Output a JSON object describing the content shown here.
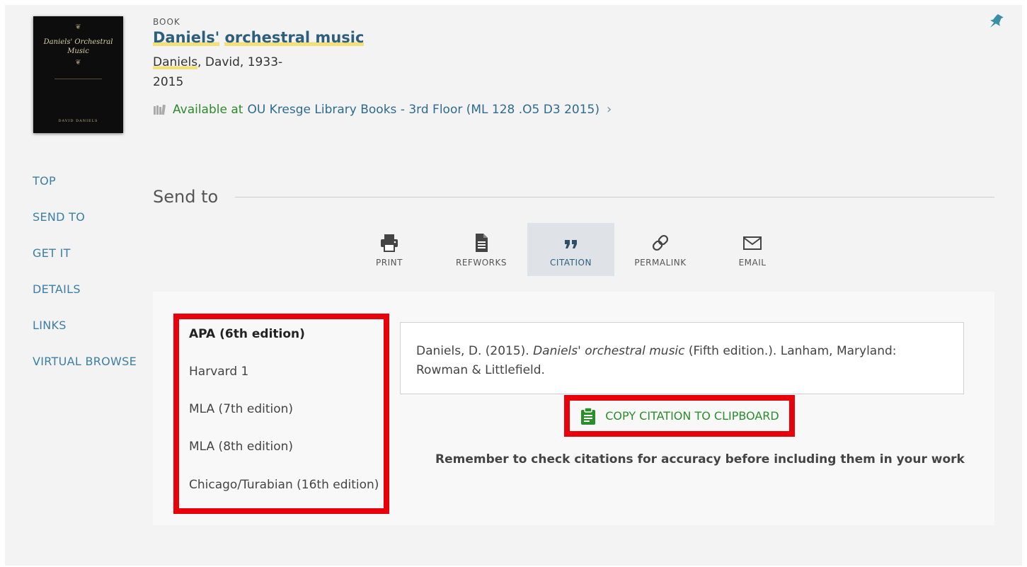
{
  "record": {
    "type": "BOOK",
    "title_part1": "Daniels'",
    "title_part2": "orchestral music",
    "author_highlight": "Daniels",
    "author_rest": ", David, 1933-",
    "year": "2015",
    "availability_status": "Available at",
    "availability_location": "OU Kresge Library  Books - 3rd Floor (ML 128 .O5 D3 2015)",
    "cover": {
      "title": "Daniels' Orchestral Music",
      "author": "DAVID DANIELS"
    }
  },
  "sidenav": [
    "TOP",
    "SEND TO",
    "GET IT",
    "DETAILS",
    "LINKS",
    "VIRTUAL BROWSE"
  ],
  "send_to": {
    "title": "Send to",
    "actions": [
      {
        "label": "PRINT",
        "icon": "print-icon"
      },
      {
        "label": "REFWORKS",
        "icon": "document-icon"
      },
      {
        "label": "CITATION",
        "icon": "quote-icon",
        "active": true
      },
      {
        "label": "PERMALINK",
        "icon": "link-icon"
      },
      {
        "label": "EMAIL",
        "icon": "envelope-icon"
      }
    ]
  },
  "citation": {
    "styles": [
      {
        "label": "APA (6th edition)",
        "selected": true
      },
      {
        "label": "Harvard 1"
      },
      {
        "label": "MLA (7th edition)"
      },
      {
        "label": "MLA (8th edition)"
      },
      {
        "label": "Chicago/Turabian (16th edition)"
      }
    ],
    "text_before": "Daniels, D. (2015). ",
    "text_title": "Daniels' orchestral music",
    "text_after": " (Fifth edition.). Lanham, Maryland: Rowman & Littlefield.",
    "copy_label": "COPY CITATION TO CLIPBOARD",
    "reminder": "Remember to check citations for accuracy before including them in your work"
  },
  "colors": {
    "link": "#3c7ea5",
    "title": "#2d5f7d",
    "available": "#2c8a2c",
    "annotation_red": "#e8000b",
    "highlight": "#f4e07a"
  }
}
